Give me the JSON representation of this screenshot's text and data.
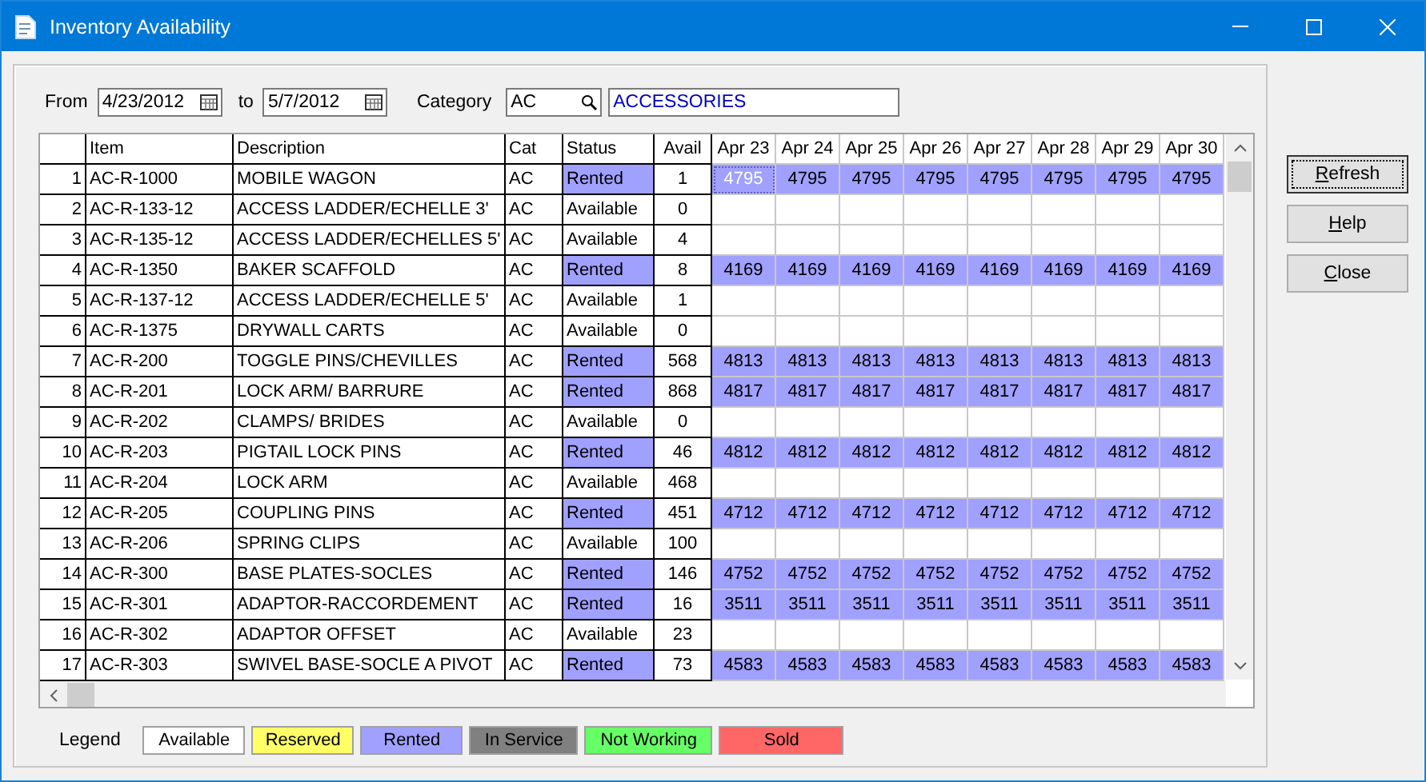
{
  "window": {
    "title": "Inventory Availability"
  },
  "filter": {
    "from_label": "From",
    "from": "4/23/2012",
    "to_label": "to",
    "to": "5/7/2012",
    "category_label": "Category",
    "category": "AC",
    "category_name": "ACCESSORIES"
  },
  "table": {
    "columns": [
      "Item",
      "Description",
      "Cat",
      "Status",
      "Avail",
      "Apr 23",
      "Apr 24",
      "Apr 25",
      "Apr 26",
      "Apr 27",
      "Apr 28",
      "Apr 29",
      "Apr 30"
    ],
    "rows": [
      {
        "num": "1",
        "item": "AC-R-1000",
        "description": "MOBILE WAGON",
        "cat": "AC",
        "status": "Rented",
        "kind": "rented",
        "avail": "1",
        "selected": true,
        "days": [
          "4795",
          "4795",
          "4795",
          "4795",
          "4795",
          "4795",
          "4795",
          "4795"
        ]
      },
      {
        "num": "2",
        "item": "AC-R-133-12",
        "description": "ACCESS LADDER/ECHELLE 3'",
        "cat": "AC",
        "status": "Available",
        "kind": "available",
        "avail": "0",
        "selected": false
      },
      {
        "num": "3",
        "item": "AC-R-135-12",
        "description": "ACCESS LADDER/ECHELLES 5'",
        "cat": "AC",
        "status": "Available",
        "kind": "available",
        "avail": "4",
        "selected": false
      },
      {
        "num": "4",
        "item": "AC-R-1350",
        "description": "BAKER SCAFFOLD",
        "cat": "AC",
        "status": "Rented",
        "kind": "rented",
        "avail": "8",
        "selected": false,
        "days": [
          "4169",
          "4169",
          "4169",
          "4169",
          "4169",
          "4169",
          "4169",
          "4169"
        ]
      },
      {
        "num": "5",
        "item": "AC-R-137-12",
        "description": "ACCESS LADDER/ECHELLE 5'",
        "cat": "AC",
        "status": "Available",
        "kind": "available",
        "avail": "1",
        "selected": false
      },
      {
        "num": "6",
        "item": "AC-R-1375",
        "description": "DRYWALL CARTS",
        "cat": "AC",
        "status": "Available",
        "kind": "available",
        "avail": "0",
        "selected": false
      },
      {
        "num": "7",
        "item": "AC-R-200",
        "description": "TOGGLE PINS/CHEVILLES",
        "cat": "AC",
        "status": "Rented",
        "kind": "rented",
        "avail": "568",
        "selected": false,
        "days": [
          "4813",
          "4813",
          "4813",
          "4813",
          "4813",
          "4813",
          "4813",
          "4813"
        ]
      },
      {
        "num": "8",
        "item": "AC-R-201",
        "description": "LOCK ARM/ BARRURE",
        "cat": "AC",
        "status": "Rented",
        "kind": "rented",
        "avail": "868",
        "selected": false,
        "days": [
          "4817",
          "4817",
          "4817",
          "4817",
          "4817",
          "4817",
          "4817",
          "4817"
        ]
      },
      {
        "num": "9",
        "item": "AC-R-202",
        "description": "CLAMPS/ BRIDES",
        "cat": "AC",
        "status": "Available",
        "kind": "available",
        "avail": "0",
        "selected": false
      },
      {
        "num": "10",
        "item": "AC-R-203",
        "description": "PIGTAIL LOCK PINS",
        "cat": "AC",
        "status": "Rented",
        "kind": "rented",
        "avail": "46",
        "selected": false,
        "days": [
          "4812",
          "4812",
          "4812",
          "4812",
          "4812",
          "4812",
          "4812",
          "4812"
        ]
      },
      {
        "num": "11",
        "item": "AC-R-204",
        "description": "LOCK ARM",
        "cat": "AC",
        "status": "Available",
        "kind": "available",
        "avail": "468",
        "selected": false
      },
      {
        "num": "12",
        "item": "AC-R-205",
        "description": "COUPLING PINS",
        "cat": "AC",
        "status": "Rented",
        "kind": "rented",
        "avail": "451",
        "selected": false,
        "days": [
          "4712",
          "4712",
          "4712",
          "4712",
          "4712",
          "4712",
          "4712",
          "4712"
        ]
      },
      {
        "num": "13",
        "item": "AC-R-206",
        "description": "SPRING CLIPS",
        "cat": "AC",
        "status": "Available",
        "kind": "available",
        "avail": "100",
        "selected": false
      },
      {
        "num": "14",
        "item": "AC-R-300",
        "description": "BASE PLATES-SOCLES",
        "cat": "AC",
        "status": "Rented",
        "kind": "rented",
        "avail": "146",
        "selected": false,
        "days": [
          "4752",
          "4752",
          "4752",
          "4752",
          "4752",
          "4752",
          "4752",
          "4752"
        ]
      },
      {
        "num": "15",
        "item": "AC-R-301",
        "description": "ADAPTOR-RACCORDEMENT",
        "cat": "AC",
        "status": "Rented",
        "kind": "rented",
        "avail": "16",
        "selected": false,
        "days": [
          "3511",
          "3511",
          "3511",
          "3511",
          "3511",
          "3511",
          "3511",
          "3511"
        ]
      },
      {
        "num": "16",
        "item": "AC-R-302",
        "description": "ADAPTOR OFFSET",
        "cat": "AC",
        "status": "Available",
        "kind": "available",
        "avail": "23",
        "selected": false
      },
      {
        "num": "17",
        "item": "AC-R-303",
        "description": "SWIVEL BASE-SOCLE A PIVOT",
        "cat": "AC",
        "status": "Rented",
        "kind": "rented",
        "avail": "73",
        "selected": false,
        "days": [
          "4583",
          "4583",
          "4583",
          "4583",
          "4583",
          "4583",
          "4583",
          "4583"
        ]
      }
    ]
  },
  "buttons": [
    {
      "key": "R",
      "rest": "efresh",
      "focused": true
    },
    {
      "key": "H",
      "rest": "elp",
      "focused": false
    },
    {
      "key": "C",
      "rest": "lose",
      "focused": false
    }
  ],
  "legend": {
    "label": "Legend",
    "items": [
      {
        "label": "Available",
        "kind": "available",
        "color": "#ffffff"
      },
      {
        "label": "Reserved",
        "kind": "reserved",
        "color": "#ffff66"
      },
      {
        "label": "Rented",
        "kind": "rented",
        "color": "#a0a0ff"
      },
      {
        "label": "In Service",
        "kind": "in_service",
        "color": "#808080"
      },
      {
        "label": "Not Working",
        "kind": "not_working",
        "color": "#66ff66"
      },
      {
        "label": "Sold",
        "kind": "sold",
        "color": "#ff6666"
      }
    ]
  }
}
